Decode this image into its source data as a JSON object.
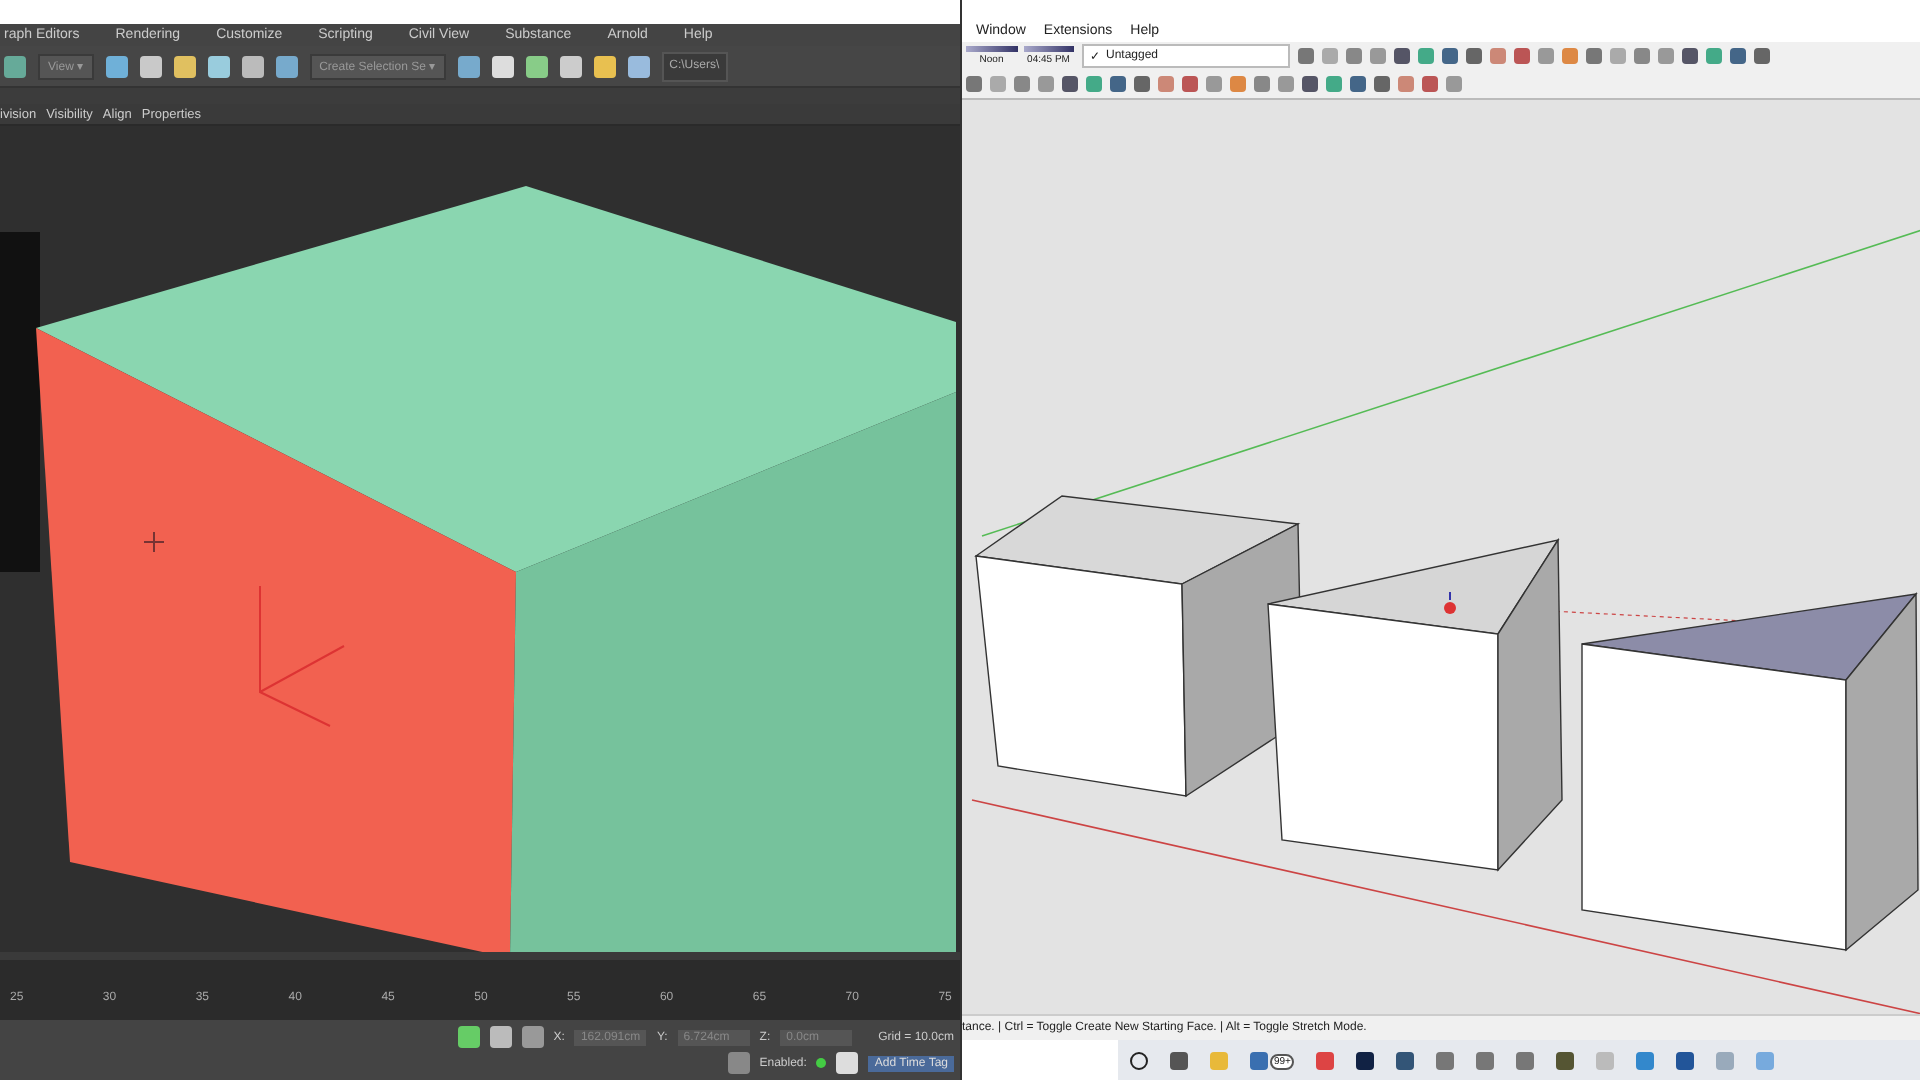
{
  "left_app": {
    "menu": [
      "raph Editors",
      "Rendering",
      "Customize",
      "Scripting",
      "Civil View",
      "Substance",
      "Arnold",
      "Help"
    ],
    "toolbar": {
      "view_dropdown": "View",
      "view_arrow": "▾",
      "selection_set": "Create Selection Se",
      "selection_arrow": "▾",
      "path_field": "C:\\Users\\"
    },
    "ribbon_tabs": [
      {
        "label": "ivision"
      },
      {
        "label": "Visibility"
      },
      {
        "label": "Align"
      },
      {
        "label": "Properties"
      }
    ],
    "timeline_ticks": [
      "25",
      "30",
      "35",
      "40",
      "45",
      "50",
      "55",
      "60",
      "65",
      "70",
      "75"
    ],
    "status": {
      "x_label": "X:",
      "x_value": "162.091cm",
      "y_label": "Y:",
      "y_value": "6.724cm",
      "z_label": "Z:",
      "z_value": "0.0cm",
      "grid": "Grid = 10.0cm",
      "enabled_label": "Enabled:",
      "enabled": true,
      "add_time_tag": "Add Time Tag"
    }
  },
  "right_app": {
    "menu": [
      "Window",
      "Extensions",
      "Help"
    ],
    "shadow_times": {
      "start": "Noon",
      "end": "04:45 PM"
    },
    "tag_dropdown": {
      "checked": true,
      "check_mark": "✓",
      "value": "Untagged"
    },
    "status_text": "tance. | Ctrl = Toggle Create New Starting Face. | Alt = Toggle Stretch Mode.",
    "taskbar_badge": "99+"
  }
}
